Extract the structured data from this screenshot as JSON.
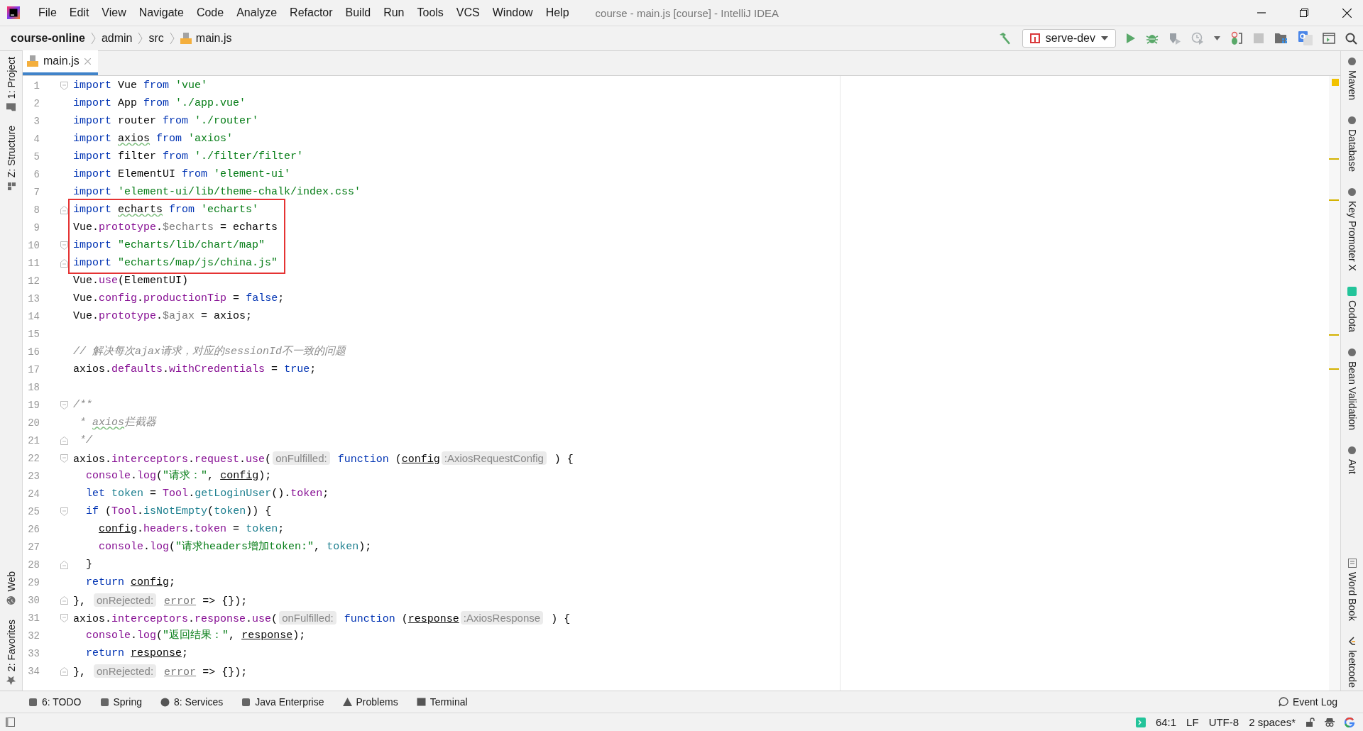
{
  "window": {
    "title": "course - main.js [course] - IntelliJ IDEA"
  },
  "menu": [
    "File",
    "Edit",
    "View",
    "Navigate",
    "Code",
    "Analyze",
    "Refactor",
    "Build",
    "Run",
    "Tools",
    "VCS",
    "Window",
    "Help"
  ],
  "breadcrumbs": [
    "course-online",
    "admin",
    "src",
    "main.js"
  ],
  "run_config": {
    "label": "serve-dev"
  },
  "left_tool_windows": {
    "top": [
      "1: Project",
      "Z: Structure"
    ],
    "bottom": [
      "Web",
      "2: Favorites"
    ]
  },
  "right_tool_windows": {
    "top": [
      "Maven",
      "Database",
      "Key Promoter X",
      "Codota",
      "Bean Validation",
      "Ant"
    ],
    "bottom": [
      "Word Book",
      "leetcode"
    ]
  },
  "tabs": [
    {
      "label": "main.js",
      "selected": true
    }
  ],
  "code_lines": [
    {
      "number": "1",
      "fold_start": true,
      "tokens": [
        {
          "kind": "k",
          "text": "import "
        },
        {
          "kind": "n",
          "text": "Vue "
        },
        {
          "kind": "k",
          "text": "from "
        },
        {
          "kind": "s",
          "text": "'vue'"
        }
      ]
    },
    {
      "number": "2",
      "tokens": [
        {
          "kind": "k",
          "text": "import "
        },
        {
          "kind": "n",
          "text": "App "
        },
        {
          "kind": "k",
          "text": "from "
        },
        {
          "kind": "s",
          "text": "'./app.vue'"
        }
      ]
    },
    {
      "number": "3",
      "tokens": [
        {
          "kind": "k",
          "text": "import "
        },
        {
          "kind": "n",
          "text": "router "
        },
        {
          "kind": "k",
          "text": "from "
        },
        {
          "kind": "s",
          "text": "'./router'"
        }
      ]
    },
    {
      "number": "4",
      "tokens": [
        {
          "kind": "k",
          "text": "import "
        },
        {
          "kind": "w",
          "text": "axios"
        },
        {
          "kind": "k",
          "text": " from "
        },
        {
          "kind": "s",
          "text": "'axios'"
        }
      ]
    },
    {
      "number": "5",
      "tokens": [
        {
          "kind": "k",
          "text": "import "
        },
        {
          "kind": "n",
          "text": "filter "
        },
        {
          "kind": "k",
          "text": "from "
        },
        {
          "kind": "s",
          "text": "'./filter/filter'"
        }
      ]
    },
    {
      "number": "6",
      "tokens": [
        {
          "kind": "k",
          "text": "import "
        },
        {
          "kind": "n",
          "text": "ElementUI "
        },
        {
          "kind": "k",
          "text": "from "
        },
        {
          "kind": "s",
          "text": "'element-ui'"
        }
      ]
    },
    {
      "number": "7",
      "tokens": [
        {
          "kind": "k",
          "text": "import "
        },
        {
          "kind": "s",
          "text": "'element-ui/lib/theme-chalk/index.css'"
        }
      ]
    },
    {
      "number": "8",
      "fold_end": true,
      "boxed": true,
      "tokens": [
        {
          "kind": "k",
          "text": "import "
        },
        {
          "kind": "w",
          "text": "echarts"
        },
        {
          "kind": "k",
          "text": " from "
        },
        {
          "kind": "s",
          "text": "'echarts'"
        }
      ]
    },
    {
      "number": "9",
      "boxed": true,
      "tokens": [
        {
          "kind": "n",
          "text": "Vue."
        },
        {
          "kind": "f",
          "text": "prototype"
        },
        {
          "kind": "n",
          "text": "."
        },
        {
          "kind": "d",
          "text": "$echarts"
        },
        {
          "kind": "n",
          "text": " = echarts"
        }
      ]
    },
    {
      "number": "10",
      "fold_start": true,
      "boxed": true,
      "tokens": [
        {
          "kind": "k",
          "text": "import "
        },
        {
          "kind": "s",
          "text": "\"echarts/lib/chart/map\""
        }
      ]
    },
    {
      "number": "11",
      "fold_end": true,
      "boxed": true,
      "tokens": [
        {
          "kind": "k",
          "text": "import "
        },
        {
          "kind": "s",
          "text": "\"echarts/map/js/china.js\""
        }
      ]
    },
    {
      "number": "12",
      "tokens": [
        {
          "kind": "n",
          "text": "Vue."
        },
        {
          "kind": "f",
          "text": "use"
        },
        {
          "kind": "n",
          "text": "(ElementUI)"
        }
      ]
    },
    {
      "number": "13",
      "tokens": [
        {
          "kind": "n",
          "text": "Vue."
        },
        {
          "kind": "f",
          "text": "config"
        },
        {
          "kind": "n",
          "text": "."
        },
        {
          "kind": "f",
          "text": "productionTip"
        },
        {
          "kind": "n",
          "text": " = "
        },
        {
          "kind": "k",
          "text": "false"
        },
        {
          "kind": "n",
          "text": ";"
        }
      ]
    },
    {
      "number": "14",
      "tokens": [
        {
          "kind": "n",
          "text": "Vue."
        },
        {
          "kind": "f",
          "text": "prototype"
        },
        {
          "kind": "n",
          "text": "."
        },
        {
          "kind": "d",
          "text": "$ajax"
        },
        {
          "kind": "n",
          "text": " = axios;"
        }
      ]
    },
    {
      "number": "15"
    },
    {
      "number": "16",
      "tokens": [
        {
          "kind": "c",
          "text": "// 解决每次ajax请求，对应的sessionId不一致的问题"
        }
      ]
    },
    {
      "number": "17",
      "tokens": [
        {
          "kind": "n",
          "text": "axios."
        },
        {
          "kind": "f",
          "text": "defaults"
        },
        {
          "kind": "n",
          "text": "."
        },
        {
          "kind": "f",
          "text": "withCredentials"
        },
        {
          "kind": "n",
          "text": " = "
        },
        {
          "kind": "k",
          "text": "true"
        },
        {
          "kind": "n",
          "text": ";"
        }
      ]
    },
    {
      "number": "18"
    },
    {
      "number": "19",
      "fold_start": true,
      "tokens": [
        {
          "kind": "c",
          "text": "/**"
        }
      ]
    },
    {
      "number": "20",
      "tokens": [
        {
          "kind": "c",
          "text": " * "
        },
        {
          "kind": "cw",
          "text": "axios"
        },
        {
          "kind": "c",
          "text": "拦截器"
        }
      ]
    },
    {
      "number": "21",
      "fold_end": true,
      "tokens": [
        {
          "kind": "c",
          "text": " */"
        }
      ]
    },
    {
      "number": "22",
      "fold_start": true,
      "tokens": [
        {
          "kind": "n",
          "text": "axios."
        },
        {
          "kind": "f",
          "text": "interceptors"
        },
        {
          "kind": "n",
          "text": "."
        },
        {
          "kind": "f",
          "text": "request"
        },
        {
          "kind": "n",
          "text": "."
        },
        {
          "kind": "f",
          "text": "use"
        },
        {
          "kind": "n",
          "text": "("
        },
        {
          "kind": "h",
          "text": "onFulfilled:"
        },
        {
          "kind": "k",
          "text": " function"
        },
        {
          "kind": "n",
          "text": " ("
        },
        {
          "kind": "u",
          "text": "config"
        },
        {
          "kind": "h",
          "text": ":AxiosRequestConfig"
        },
        {
          "kind": "n",
          "text": " ) {"
        }
      ]
    },
    {
      "number": "23",
      "tokens": [
        {
          "kind": "f",
          "text": "  console"
        },
        {
          "kind": "n",
          "text": "."
        },
        {
          "kind": "f",
          "text": "log"
        },
        {
          "kind": "n",
          "text": "("
        },
        {
          "kind": "s",
          "text": "\"请求：\""
        },
        {
          "kind": "n",
          "text": ", "
        },
        {
          "kind": "u",
          "text": "config"
        },
        {
          "kind": "n",
          "text": ");"
        }
      ]
    },
    {
      "number": "24",
      "tokens": [
        {
          "kind": "k",
          "text": "  let "
        },
        {
          "kind": "v",
          "text": "token"
        },
        {
          "kind": "n",
          "text": " = "
        },
        {
          "kind": "f",
          "text": "Tool"
        },
        {
          "kind": "n",
          "text": "."
        },
        {
          "kind": "v",
          "text": "getLoginUser"
        },
        {
          "kind": "n",
          "text": "()."
        },
        {
          "kind": "f",
          "text": "token"
        },
        {
          "kind": "n",
          "text": ";"
        }
      ]
    },
    {
      "number": "25",
      "fold_start": true,
      "tokens": [
        {
          "kind": "k",
          "text": "  if"
        },
        {
          "kind": "n",
          "text": " ("
        },
        {
          "kind": "f",
          "text": "Tool"
        },
        {
          "kind": "n",
          "text": "."
        },
        {
          "kind": "v",
          "text": "isNotEmpty"
        },
        {
          "kind": "n",
          "text": "("
        },
        {
          "kind": "v",
          "text": "token"
        },
        {
          "kind": "n",
          "text": ")) {"
        }
      ]
    },
    {
      "number": "26",
      "tokens": [
        {
          "kind": "u",
          "text": "    config"
        },
        {
          "kind": "n",
          "text": "."
        },
        {
          "kind": "f",
          "text": "headers"
        },
        {
          "kind": "n",
          "text": "."
        },
        {
          "kind": "f",
          "text": "token"
        },
        {
          "kind": "n",
          "text": " = "
        },
        {
          "kind": "v",
          "text": "token"
        },
        {
          "kind": "n",
          "text": ";"
        }
      ]
    },
    {
      "number": "27",
      "tokens": [
        {
          "kind": "f",
          "text": "    console"
        },
        {
          "kind": "n",
          "text": "."
        },
        {
          "kind": "f",
          "text": "log"
        },
        {
          "kind": "n",
          "text": "("
        },
        {
          "kind": "s",
          "text": "\"请求headers增加token:\""
        },
        {
          "kind": "n",
          "text": ", "
        },
        {
          "kind": "v",
          "text": "token"
        },
        {
          "kind": "n",
          "text": ");"
        }
      ]
    },
    {
      "number": "28",
      "fold_end": true,
      "tokens": [
        {
          "kind": "n",
          "text": "  }"
        }
      ]
    },
    {
      "number": "29",
      "tokens": [
        {
          "kind": "k",
          "text": "  return "
        },
        {
          "kind": "u",
          "text": "config"
        },
        {
          "kind": "n",
          "text": ";"
        }
      ]
    },
    {
      "number": "30",
      "fold_end": true,
      "tokens": [
        {
          "kind": "n",
          "text": "}, "
        },
        {
          "kind": "h",
          "text": "onRejected:"
        },
        {
          "kind": "ug",
          "text": " error"
        },
        {
          "kind": "n",
          "text": " => {});"
        }
      ]
    },
    {
      "number": "31",
      "fold_start": true,
      "tokens": [
        {
          "kind": "n",
          "text": "axios."
        },
        {
          "kind": "f",
          "text": "interceptors"
        },
        {
          "kind": "n",
          "text": "."
        },
        {
          "kind": "f",
          "text": "response"
        },
        {
          "kind": "n",
          "text": "."
        },
        {
          "kind": "f",
          "text": "use"
        },
        {
          "kind": "n",
          "text": "("
        },
        {
          "kind": "h",
          "text": "onFulfilled:"
        },
        {
          "kind": "k",
          "text": " function"
        },
        {
          "kind": "n",
          "text": " ("
        },
        {
          "kind": "u",
          "text": "response"
        },
        {
          "kind": "h",
          "text": ":AxiosResponse"
        },
        {
          "kind": "n",
          "text": " ) {"
        }
      ]
    },
    {
      "number": "32",
      "tokens": [
        {
          "kind": "f",
          "text": "  console"
        },
        {
          "kind": "n",
          "text": "."
        },
        {
          "kind": "f",
          "text": "log"
        },
        {
          "kind": "n",
          "text": "("
        },
        {
          "kind": "s",
          "text": "\"返回结果：\""
        },
        {
          "kind": "n",
          "text": ", "
        },
        {
          "kind": "u",
          "text": "response"
        },
        {
          "kind": "n",
          "text": ");"
        }
      ]
    },
    {
      "number": "33",
      "tokens": [
        {
          "kind": "k",
          "text": "  return "
        },
        {
          "kind": "u",
          "text": "response"
        },
        {
          "kind": "n",
          "text": ";"
        }
      ]
    },
    {
      "number": "34",
      "fold_end": true,
      "tokens": [
        {
          "kind": "n",
          "text": "}, "
        },
        {
          "kind": "h",
          "text": "onRejected:"
        },
        {
          "kind": "ug",
          "text": " error"
        },
        {
          "kind": "n",
          "text": " => {});"
        }
      ]
    }
  ],
  "bottom_tool_windows": [
    "6: TODO",
    "Spring",
    "8: Services",
    "Java Enterprise",
    "Problems",
    "Terminal"
  ],
  "event_log": "Event Log",
  "status_bar": {
    "position": "64:1",
    "line_separator": "LF",
    "encoding": "UTF-8",
    "indent": "2 spaces*"
  }
}
